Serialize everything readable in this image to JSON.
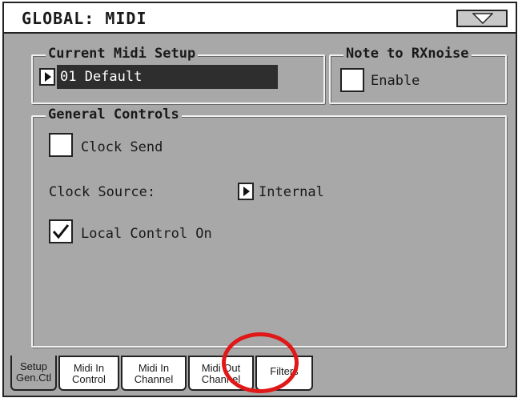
{
  "window": {
    "title": "GLOBAL: MIDI"
  },
  "current_midi_setup": {
    "title": "Current Midi Setup",
    "value": "01 Default"
  },
  "note_to_rxnoise": {
    "title": "Note to RXnoise",
    "enable_label": "Enable",
    "enabled": false
  },
  "general_controls": {
    "title": "General Controls",
    "clock_send": {
      "label": "Clock Send",
      "checked": false
    },
    "clock_source": {
      "label": "Clock Source:",
      "value": "Internal"
    },
    "local_control": {
      "label": "Local Control On",
      "checked": true
    }
  },
  "tabs": [
    {
      "line1": "Setup",
      "line2": "Gen.Ctl",
      "active": true
    },
    {
      "line1": "Midi In",
      "line2": "Control",
      "active": false
    },
    {
      "line1": "Midi In",
      "line2": "Channel",
      "active": false
    },
    {
      "line1": "Midi Out",
      "line2": "Channel",
      "active": false
    },
    {
      "line1": "Filters",
      "line2": "",
      "active": false
    }
  ],
  "colors": {
    "highlight_ring": "#e01818",
    "panel": "#a8a8a8",
    "value_box": "#2e2e2e"
  },
  "icons": {
    "menu": "triangle-down-icon",
    "selector": "triangle-right-icon",
    "check": "checkmark-icon"
  }
}
